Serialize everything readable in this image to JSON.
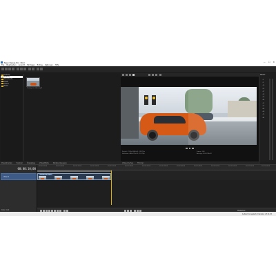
{
  "window": {
    "title": "New Vegas Pro 16.0",
    "buttons": [
      "—",
      "☐",
      "✕"
    ]
  },
  "menu": [
    "File",
    "Bearbeiten",
    "Ansicht",
    "Einfügen",
    "Extras",
    "Optionen",
    "Hilfe"
  ],
  "explorer": {
    "tree": [
      {
        "label": "Desktop",
        "selected": false
      },
      {
        "label": "Desktop",
        "selected": true
      },
      {
        "label": "Dokumente",
        "selected": false
      },
      {
        "label": "Musik",
        "selected": false
      },
      {
        "label": "Videos",
        "selected": false
      },
      {
        "label": "Bilder",
        "selected": false
      }
    ],
    "file": {
      "name": "Snowy car video.mp4"
    },
    "tabs": [
      "Projektmedien",
      "Explorer",
      "Übergänge",
      "Videoeffekte",
      "Medienerzeugung"
    ]
  },
  "preview": {
    "info_left": [
      "Projekt: 1920x1080x32, 29,970p",
      "Vorschau: 480x270x32, 29,970p"
    ],
    "info_right": [
      "Frame: 300",
      "Anzeige: 561x316x32"
    ],
    "tabs": [
      "Videovorschau",
      "Trimmer"
    ]
  },
  "meters": {
    "title": "Master",
    "labels": [
      "-3",
      "-6",
      "-9",
      "-12",
      "-15",
      "-18",
      "-21",
      "-24",
      "-27",
      "-30",
      "-33",
      "-36",
      "-39",
      "-42",
      "-45",
      "-48",
      "-51",
      "-54",
      "-57",
      "-60",
      "-63",
      "-66",
      "-69",
      "-72",
      "-75",
      "-78",
      "-81",
      "-84"
    ]
  },
  "timeline": {
    "timecode": "00:00:10;00",
    "track": {
      "name": "Video 1"
    },
    "ruler": [
      "00:00:00;00",
      "00:00:05;00",
      "00:00:10;00",
      "00:00:15;00",
      "00:00:20;00",
      "00:00:25;00",
      "00:00:30;00",
      "00:00:35;00",
      "00:00:40;00",
      "00:00:45;00",
      "00:00:50;00",
      "00:00:55;00",
      "00:01:00;00",
      "00:01:05;00",
      "00:01:10;00"
    ],
    "clip": {
      "name": "Snowy car video"
    },
    "rate": "Rate: 0,00",
    "master_bus": "Masterbus"
  },
  "status": "Aufzeichnungszeit (2 Kanäle): 23:21:45"
}
